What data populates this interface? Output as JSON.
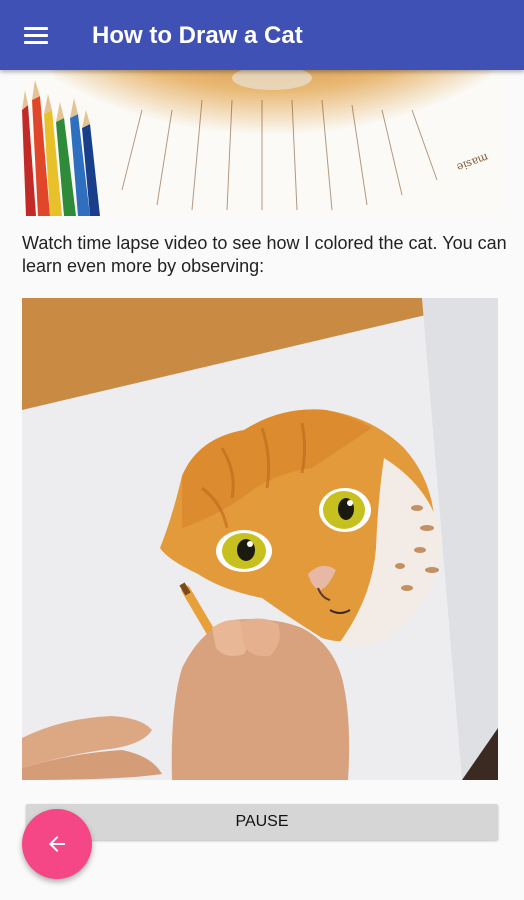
{
  "app_bar": {
    "title": "How to Draw a Cat",
    "menu_icon": "hamburger-menu-icon",
    "background_color": "#3f51b5"
  },
  "content": {
    "description": "Watch time lapse video to see  how I colored the  cat. You can learn even more by observing:",
    "pause_button_label": "PAUSE"
  },
  "fab": {
    "icon": "arrow-left-icon",
    "color": "#f54785"
  }
}
